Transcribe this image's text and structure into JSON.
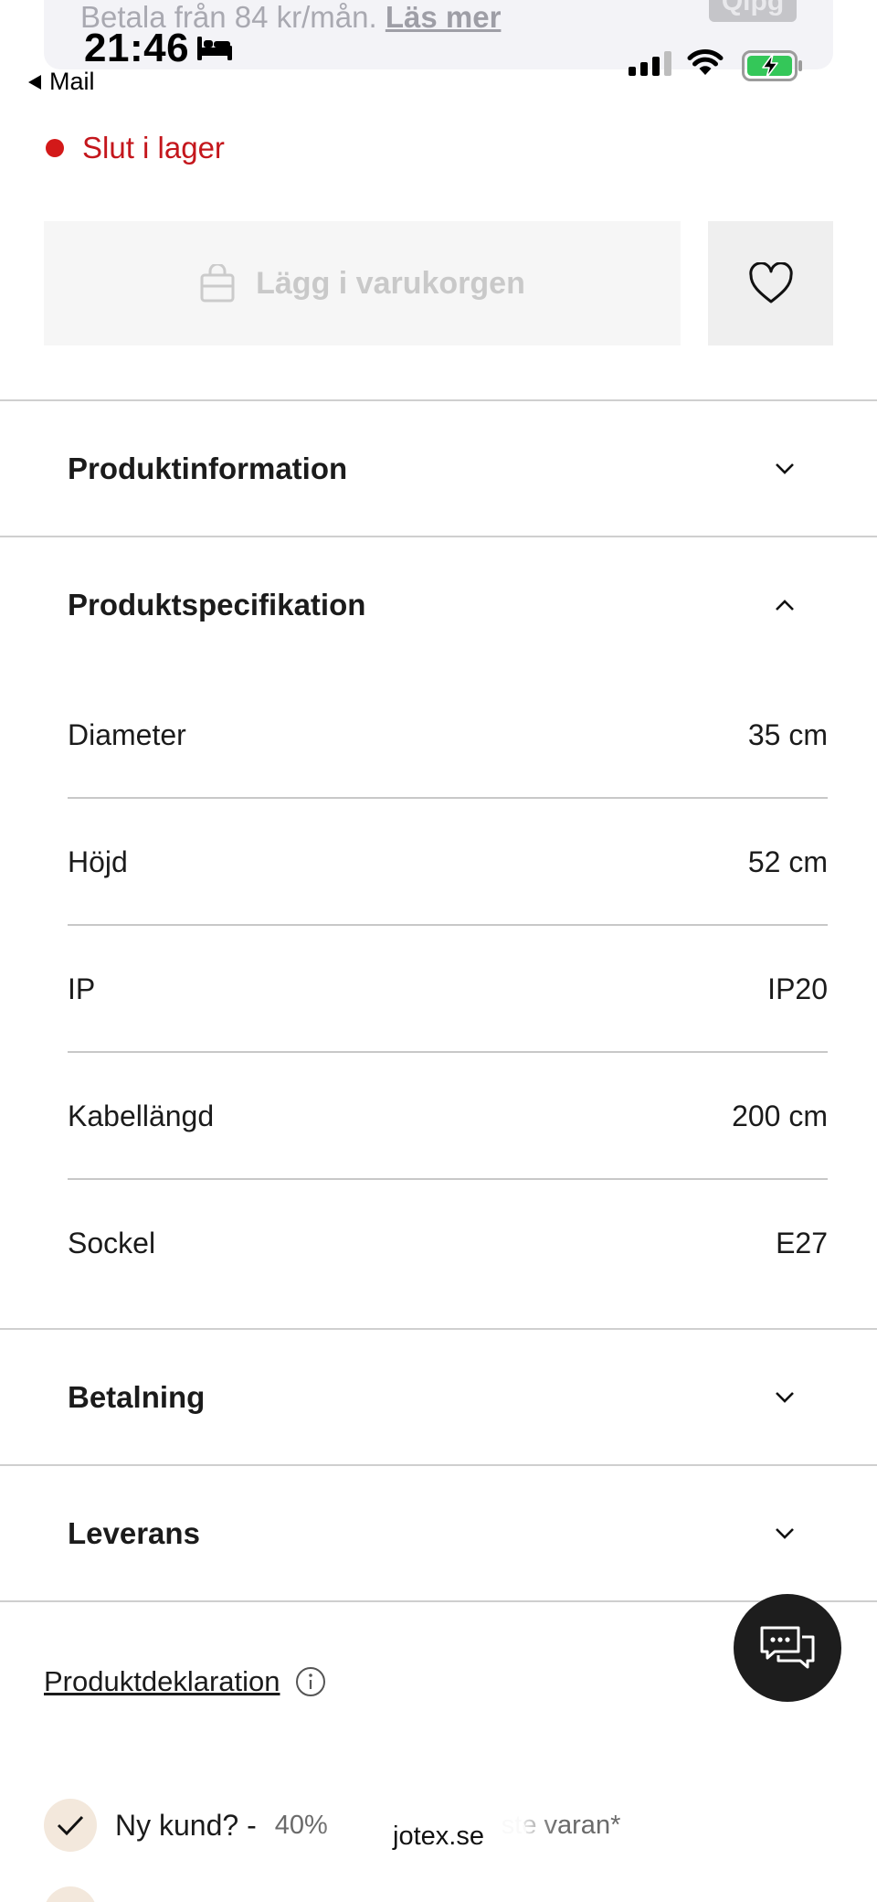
{
  "klarna": {
    "text": "Betala från 84 kr/mån.",
    "link": "Läs mer",
    "badge": "Qlpg"
  },
  "status_bar": {
    "time": "21:46",
    "back_label": "Mail",
    "battery_charging": true,
    "icons": [
      "bed-icon",
      "signal-icon",
      "wifi-icon",
      "battery-icon"
    ]
  },
  "product": {
    "stock_status": "Slut i lager",
    "stock_color": "#d31919",
    "add_to_cart_label": "Lägg i varukorgen"
  },
  "accordions": {
    "produktinformation": "Produktinformation",
    "produktspecifikation": "Produktspecifikation",
    "betalning": "Betalning",
    "leverans": "Leverans"
  },
  "specs": [
    {
      "label": "Diameter",
      "value": "35 cm"
    },
    {
      "label": "Höjd",
      "value": "52 cm"
    },
    {
      "label": "IP",
      "value": "IP20"
    },
    {
      "label": "Kabellängd",
      "value": "200 cm"
    },
    {
      "label": "Sockel",
      "value": "E27"
    }
  ],
  "declaration": {
    "link": "Produktdeklaration"
  },
  "promo": {
    "strong": "Ny kund? -",
    "rest_left": "40%",
    "rest_right": "ste varan*"
  },
  "browser": {
    "url": "jotex.se"
  }
}
